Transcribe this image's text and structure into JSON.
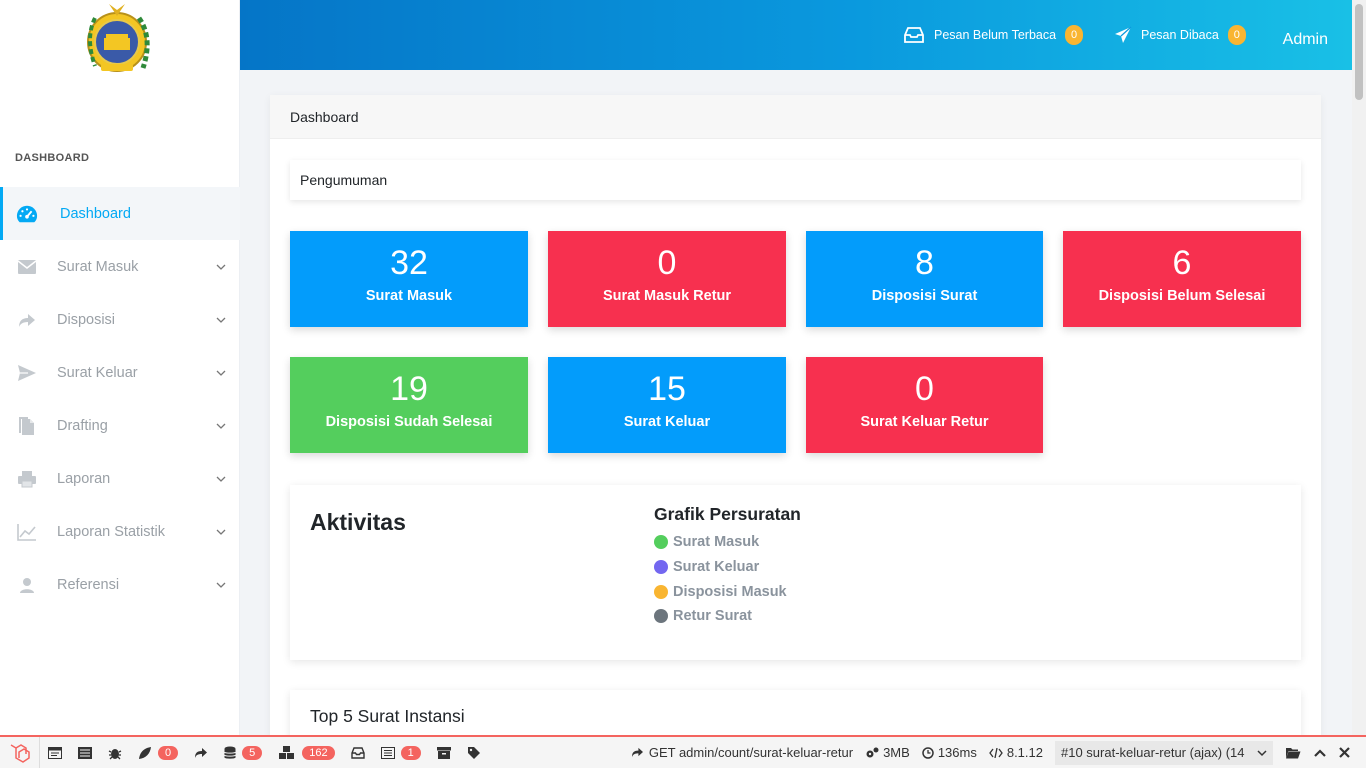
{
  "sidebar": {
    "section_label": "DASHBOARD",
    "items": [
      {
        "label": "Dashboard",
        "icon": "speedometer-icon"
      },
      {
        "label": "Surat Masuk",
        "icon": "mail-icon"
      },
      {
        "label": "Disposisi",
        "icon": "share-arrow-icon"
      },
      {
        "label": "Surat Keluar",
        "icon": "send-icon"
      },
      {
        "label": "Drafting",
        "icon": "document-icon"
      },
      {
        "label": "Laporan",
        "icon": "printer-icon"
      },
      {
        "label": "Laporan Statistik",
        "icon": "line-chart-icon"
      },
      {
        "label": "Referensi",
        "icon": "user-icon"
      }
    ]
  },
  "topbar": {
    "unread_label": "Pesan Belum Terbaca",
    "unread_count": "0",
    "read_label": "Pesan Dibaca",
    "read_count": "0",
    "user": "Admin"
  },
  "main": {
    "breadcrumb": "Dashboard",
    "announcement": "Pengumuman",
    "stats": [
      {
        "value": "32",
        "label": "Surat Masuk",
        "color": "#039cfb"
      },
      {
        "value": "0",
        "label": "Surat Masuk Retur",
        "color": "#f7304f"
      },
      {
        "value": "8",
        "label": "Disposisi Surat",
        "color": "#039cfb"
      },
      {
        "value": "6",
        "label": "Disposisi Belum Selesai",
        "color": "#f7304f"
      },
      {
        "value": "19",
        "label": "Disposisi Sudah Selesai",
        "color": "#54ce5d"
      },
      {
        "value": "15",
        "label": "Surat Keluar",
        "color": "#039cfb"
      },
      {
        "value": "0",
        "label": "Surat Keluar Retur",
        "color": "#f7304f"
      }
    ],
    "activity_title": "Aktivitas",
    "graph_title": "Grafik Persuratan",
    "legend": [
      {
        "label": "Surat Masuk",
        "color": "#54ce5d"
      },
      {
        "label": "Surat Keluar",
        "color": "#7367f0"
      },
      {
        "label": "Disposisi Masuk",
        "color": "#f9b531"
      },
      {
        "label": "Retur Surat",
        "color": "#6c757d"
      }
    ],
    "top5_title": "Top 5 Surat Instansi"
  },
  "debugbar": {
    "badges": [
      "0",
      "5",
      "162",
      "1"
    ],
    "request": "GET admin/count/surat-keluar-retur",
    "memory": "3MB",
    "time": "136ms",
    "version": "8.1.12",
    "selected_request": "#10 surat-keluar-retur (ajax) (14"
  }
}
